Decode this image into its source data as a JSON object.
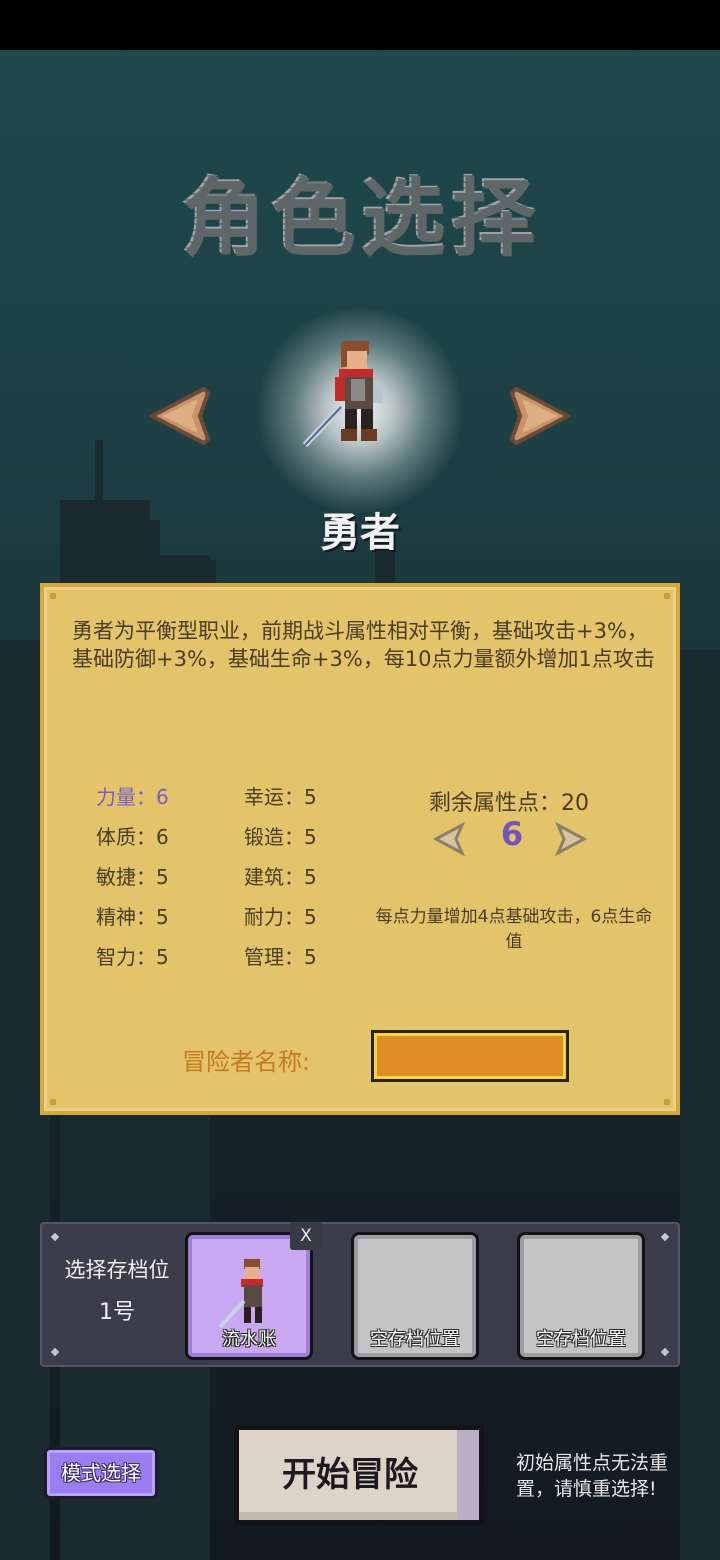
{
  "title": "角色选择",
  "character": {
    "name": "勇者"
  },
  "panel": {
    "description": "勇者为平衡型职业，前期战斗属性相对平衡，基础攻击+3%，基础防御+3%，基础生命+3%，每10点力量额外增加1点攻击",
    "stats_left": [
      {
        "label": "力量：6",
        "active": true
      },
      {
        "label": "体质：6"
      },
      {
        "label": "敏捷：5"
      },
      {
        "label": "精神：5"
      },
      {
        "label": "智力：5"
      }
    ],
    "stats_right": [
      {
        "label": "幸运：5"
      },
      {
        "label": "锻造：5"
      },
      {
        "label": "建筑：5"
      },
      {
        "label": "耐力：5"
      },
      {
        "label": "管理：5"
      }
    ],
    "remaining_points": "剩余属性点：20",
    "current_value": "6",
    "hint": "每点力量增加4点基础攻击，6点生命值",
    "name_label": "冒险者名称:",
    "name_value": ""
  },
  "saves": {
    "label": "选择存档位",
    "number": "1号",
    "close": "X",
    "slots": [
      {
        "caption": "流水账",
        "selected": true
      },
      {
        "caption": "空存档位置"
      },
      {
        "caption": "空存档位置"
      }
    ]
  },
  "buttons": {
    "mode": "模式选择",
    "start": "开始冒险"
  },
  "warning": "初始属性点无法重置，请慎重选择!",
  "colors": {
    "panel": "#e3c46a",
    "accent_purple": "#7a5cc4",
    "name_field": "#e08e24",
    "arrow": "#c9936a"
  }
}
